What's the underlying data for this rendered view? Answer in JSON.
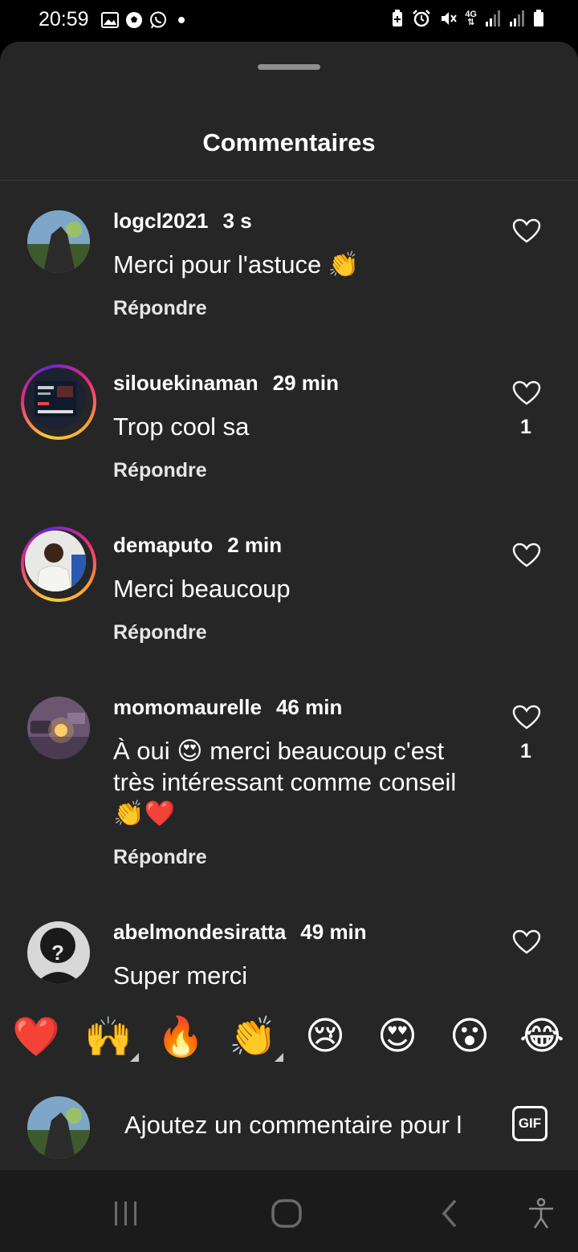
{
  "status_bar": {
    "time": "20:59",
    "left_icons": [
      "gallery-icon",
      "soccer-ball-icon",
      "whatsapp-icon"
    ],
    "right_icons": [
      "battery-saver-icon",
      "alarm-icon",
      "mute-icon",
      "4g-icon",
      "signal-icon",
      "signal-icon",
      "battery-icon"
    ],
    "network": "4G"
  },
  "sheet": {
    "title": "Commentaires"
  },
  "comments": [
    {
      "username": "logcl2021",
      "time": "3 s",
      "text": "Merci pour l'astuce 👏",
      "reply_label": "Répondre",
      "likes": "",
      "story_ring": false
    },
    {
      "username": "silouekinaman",
      "time": "29 min",
      "text": "Trop cool sa",
      "reply_label": "Répondre",
      "likes": "1",
      "story_ring": true
    },
    {
      "username": "demaputo",
      "time": "2 min",
      "text": "Merci beaucoup",
      "reply_label": "Répondre",
      "likes": "",
      "story_ring": true
    },
    {
      "username": "momomaurelle",
      "time": "46 min",
      "text": "À oui 😍 merci beaucoup c'est très intéressant comme conseil 👏❤️",
      "reply_label": "Répondre",
      "likes": "1",
      "story_ring": false
    },
    {
      "username": "abelmondesiratta",
      "time": "49 min",
      "text": "Super merci",
      "reply_label": "",
      "likes": "",
      "story_ring": false
    }
  ],
  "emoji_bar": [
    "❤️",
    "🙌",
    "🔥",
    "👏",
    "😢",
    "😍",
    "😮",
    "😂"
  ],
  "composer": {
    "placeholder": "Ajoutez un commentaire pour l",
    "gif_label": "GIF"
  },
  "nav": [
    "recent-apps-icon",
    "home-icon",
    "back-icon",
    "accessibility-icon"
  ],
  "colors": {
    "sheet_bg": "#262626",
    "heart_red": "#e0245e"
  }
}
